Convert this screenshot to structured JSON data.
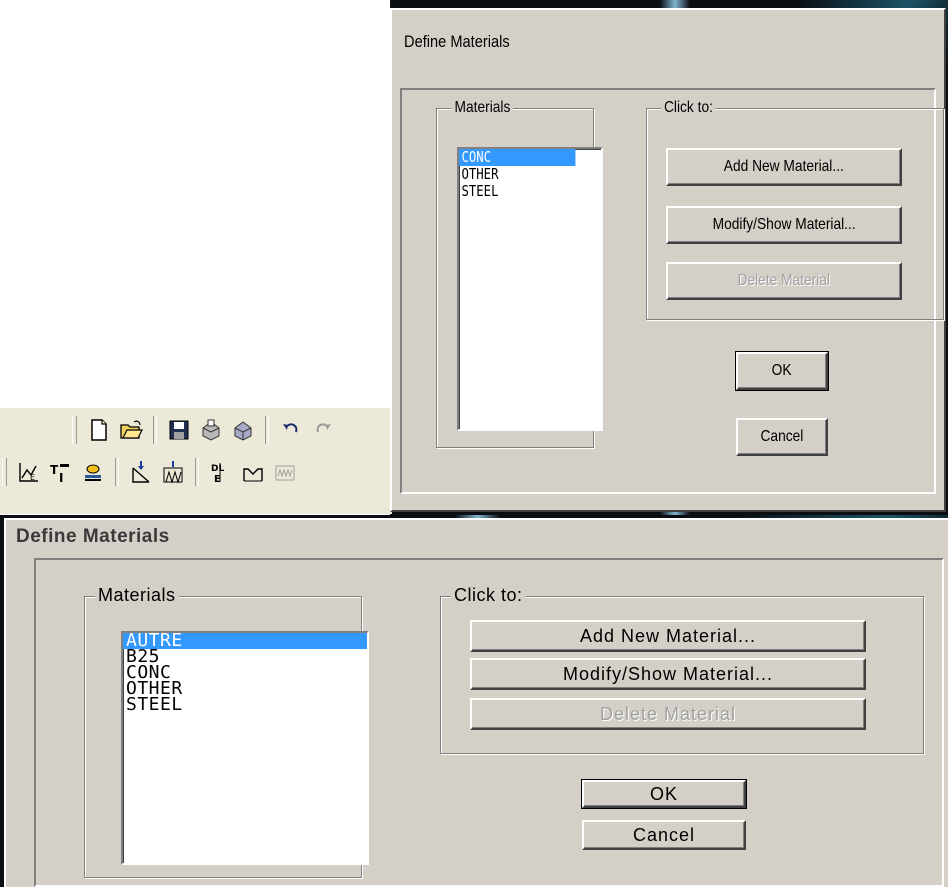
{
  "dialog_top": {
    "title": "Define Materials",
    "materials_group_label": "Materials",
    "materials": [
      {
        "name": "CONC",
        "selected": true
      },
      {
        "name": "OTHER",
        "selected": false
      },
      {
        "name": "STEEL",
        "selected": false
      }
    ],
    "click_group_label": "Click to:",
    "add_label": "Add New Material...",
    "modify_label": "Modify/Show Material...",
    "delete_label": "Delete Material",
    "ok_label": "OK",
    "cancel_label": "Cancel"
  },
  "dialog_bottom": {
    "title": "Define Materials",
    "materials_group_label": "Materials",
    "materials": [
      {
        "name": "AUTRE",
        "selected": true
      },
      {
        "name": "B25",
        "selected": false
      },
      {
        "name": "CONC",
        "selected": false
      },
      {
        "name": "OTHER",
        "selected": false
      },
      {
        "name": "STEEL",
        "selected": false
      }
    ],
    "click_group_label": "Click to:",
    "add_label": "Add New Material...",
    "modify_label": "Modify/Show Material...",
    "delete_label": "Delete Material",
    "ok_label": "OK",
    "cancel_label": "Cancel"
  },
  "toolbar": {
    "row1_icons": [
      "new-file-icon",
      "open-folder-icon",
      "save-icon",
      "print-icon",
      "print-preview-icon",
      "undo-icon",
      "redo-icon"
    ],
    "row2_icons": [
      "define-function-icon",
      "section-icon",
      "material-layer-icon",
      "load-arrow-icon",
      "load-pattern-icon",
      "load-combo-icon",
      "frame-icon",
      "response-spectrum-icon"
    ]
  },
  "colors": {
    "dialog_face": "#d4d0c8",
    "selection": "#3399ff",
    "toolbar_bg": "#ece9d8",
    "desktop_dark": "#0b0f14"
  }
}
